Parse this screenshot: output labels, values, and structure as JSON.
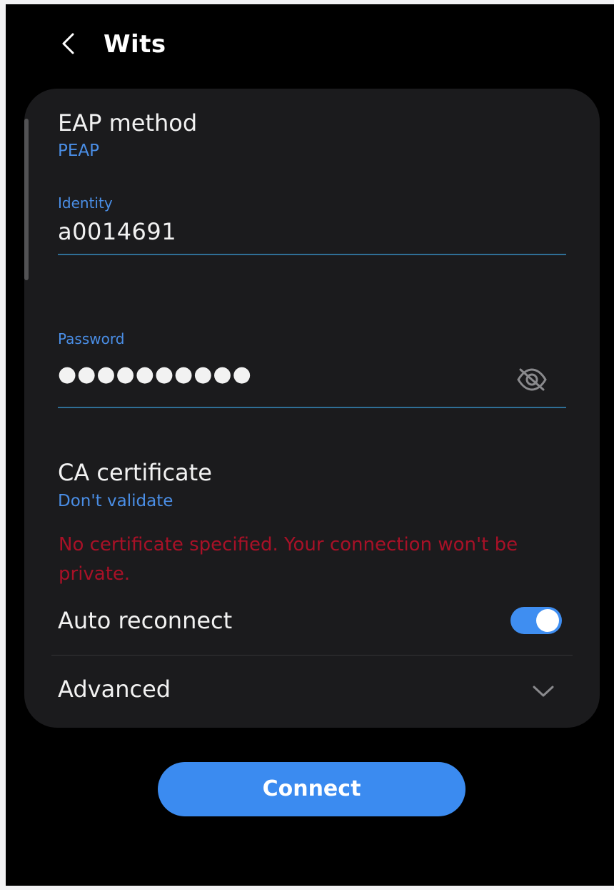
{
  "header": {
    "title": "Wits",
    "back_icon": "chevron-left-icon"
  },
  "eap": {
    "label": "EAP method",
    "value": "PEAP"
  },
  "identity": {
    "label": "Identity",
    "value": "a0014691"
  },
  "password": {
    "label": "Password",
    "masked_value": "●●●●●●●●●●",
    "visibility_icon": "eye-slash-icon"
  },
  "ca_certificate": {
    "label": "CA certificate",
    "value": "Don't validate",
    "warning": "No certificate specified. Your connection won't be private."
  },
  "auto_reconnect": {
    "label": "Auto reconnect",
    "enabled": true
  },
  "advanced": {
    "label": "Advanced",
    "icon": "chevron-down-icon"
  },
  "connect_button": {
    "label": "Connect"
  },
  "colors": {
    "accent_blue": "#4a8ee6",
    "toggle_on": "#3f8ef1",
    "button_blue": "#3b8bf0",
    "error_red": "#a81127",
    "card_bg": "#1b1b1d",
    "screen_bg": "#000000"
  }
}
